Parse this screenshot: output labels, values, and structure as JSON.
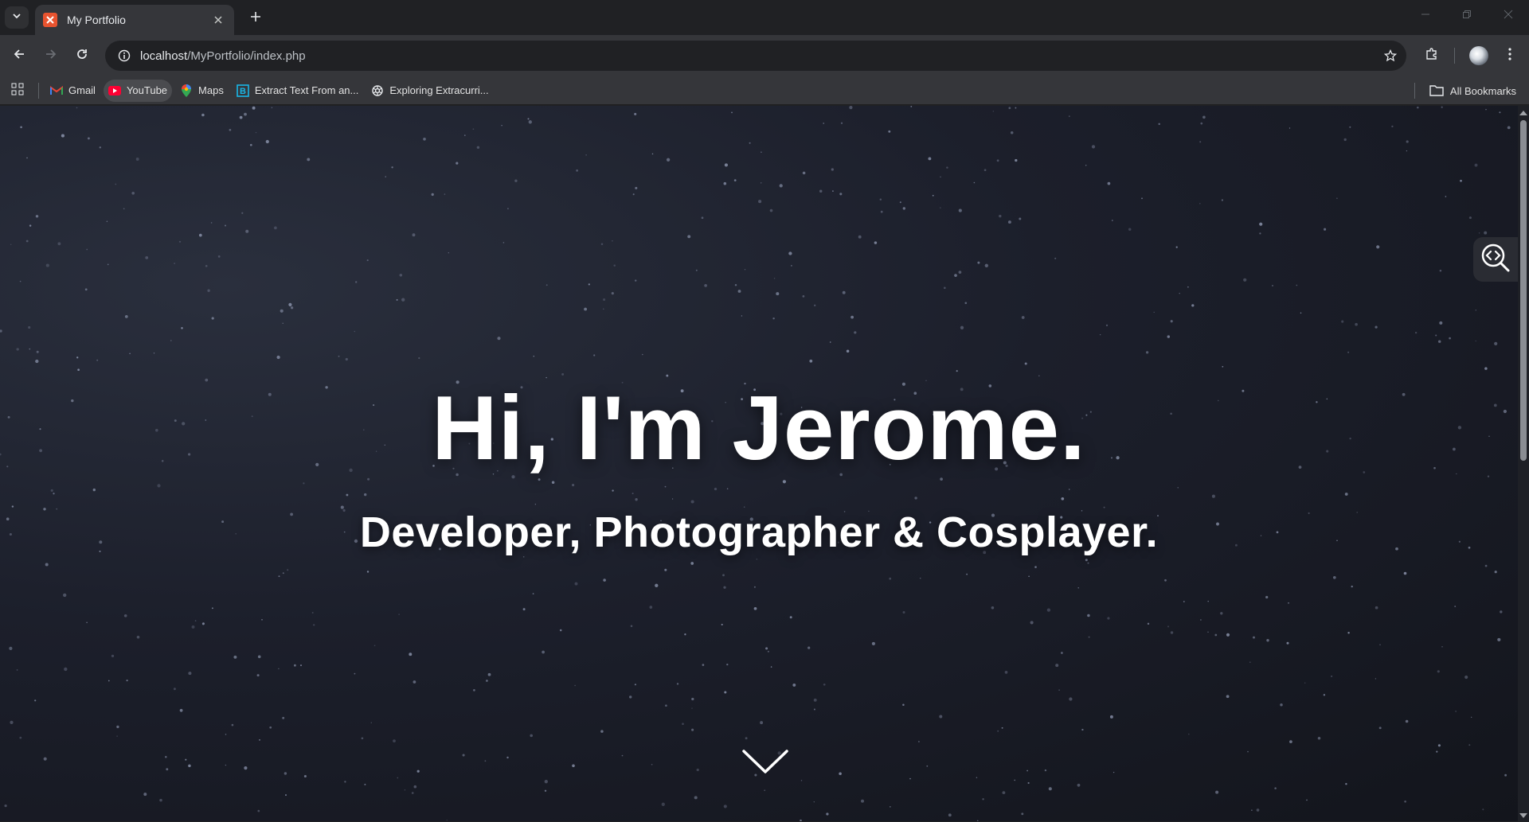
{
  "browser": {
    "tab": {
      "title": "My Portfolio",
      "favicon": "xampp-icon"
    },
    "address": {
      "host": "localhost",
      "path": "/MyPortfolio/index.php"
    },
    "bookmarks": [
      {
        "label": "Gmail",
        "icon": "gmail-icon"
      },
      {
        "label": "YouTube",
        "icon": "youtube-icon"
      },
      {
        "label": "Maps",
        "icon": "maps-icon"
      },
      {
        "label": "Extract Text From an...",
        "icon": "bookmark-b-icon"
      },
      {
        "label": "Exploring Extracurri...",
        "icon": "openai-icon"
      }
    ],
    "all_bookmarks_label": "All Bookmarks"
  },
  "page": {
    "title": "Hi, I'm Jerome.",
    "subtitle": "Developer, Photographer & Cosplayer."
  },
  "colors": {
    "background": "#1c1f2b",
    "text": "#ffffff",
    "tab_bar": "#202124",
    "toolbar": "#35363a"
  }
}
